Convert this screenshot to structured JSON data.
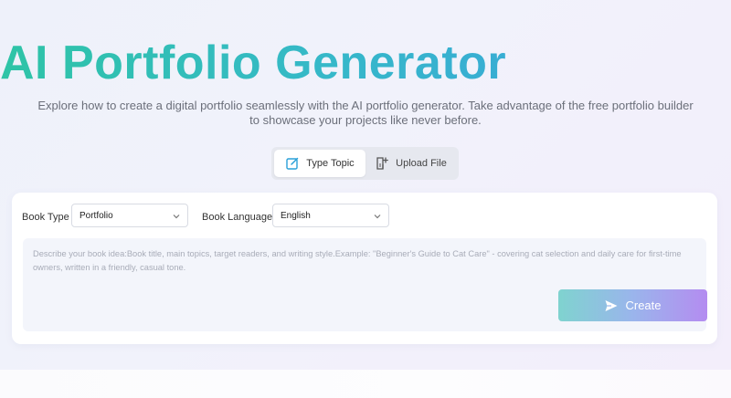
{
  "hero": {
    "title": "AI Portfolio Generator",
    "subtitle": "Explore how to create a digital portfolio seamlessly with the AI portfolio generator. Take advantage of the free portfolio builder to showcase your projects like never before."
  },
  "tabs": [
    {
      "label": "Type Topic",
      "active": true,
      "icon": "edit-icon"
    },
    {
      "label": "Upload File",
      "active": false,
      "icon": "file-upload-icon"
    }
  ],
  "form": {
    "book_type_label": "Book Type",
    "book_type_value": "Portfolio",
    "book_language_label": "Book Language",
    "book_language_value": "English",
    "description_placeholder": "Describe your book idea:Book title, main topics, target readers, and writing style.Example: \"Beginner's Guide to Cat Care\" - covering cat selection and daily care for first-time owners, written in a friendly, casual tone.",
    "create_label": "Create"
  },
  "colors": {
    "title_gradient_start": "#2ec4a6",
    "title_gradient_end": "#3aa0e0",
    "button_gradient_start": "#7fd3cf",
    "button_gradient_end": "#b48cf0",
    "tab_icon_color": "#2aa0d8"
  }
}
